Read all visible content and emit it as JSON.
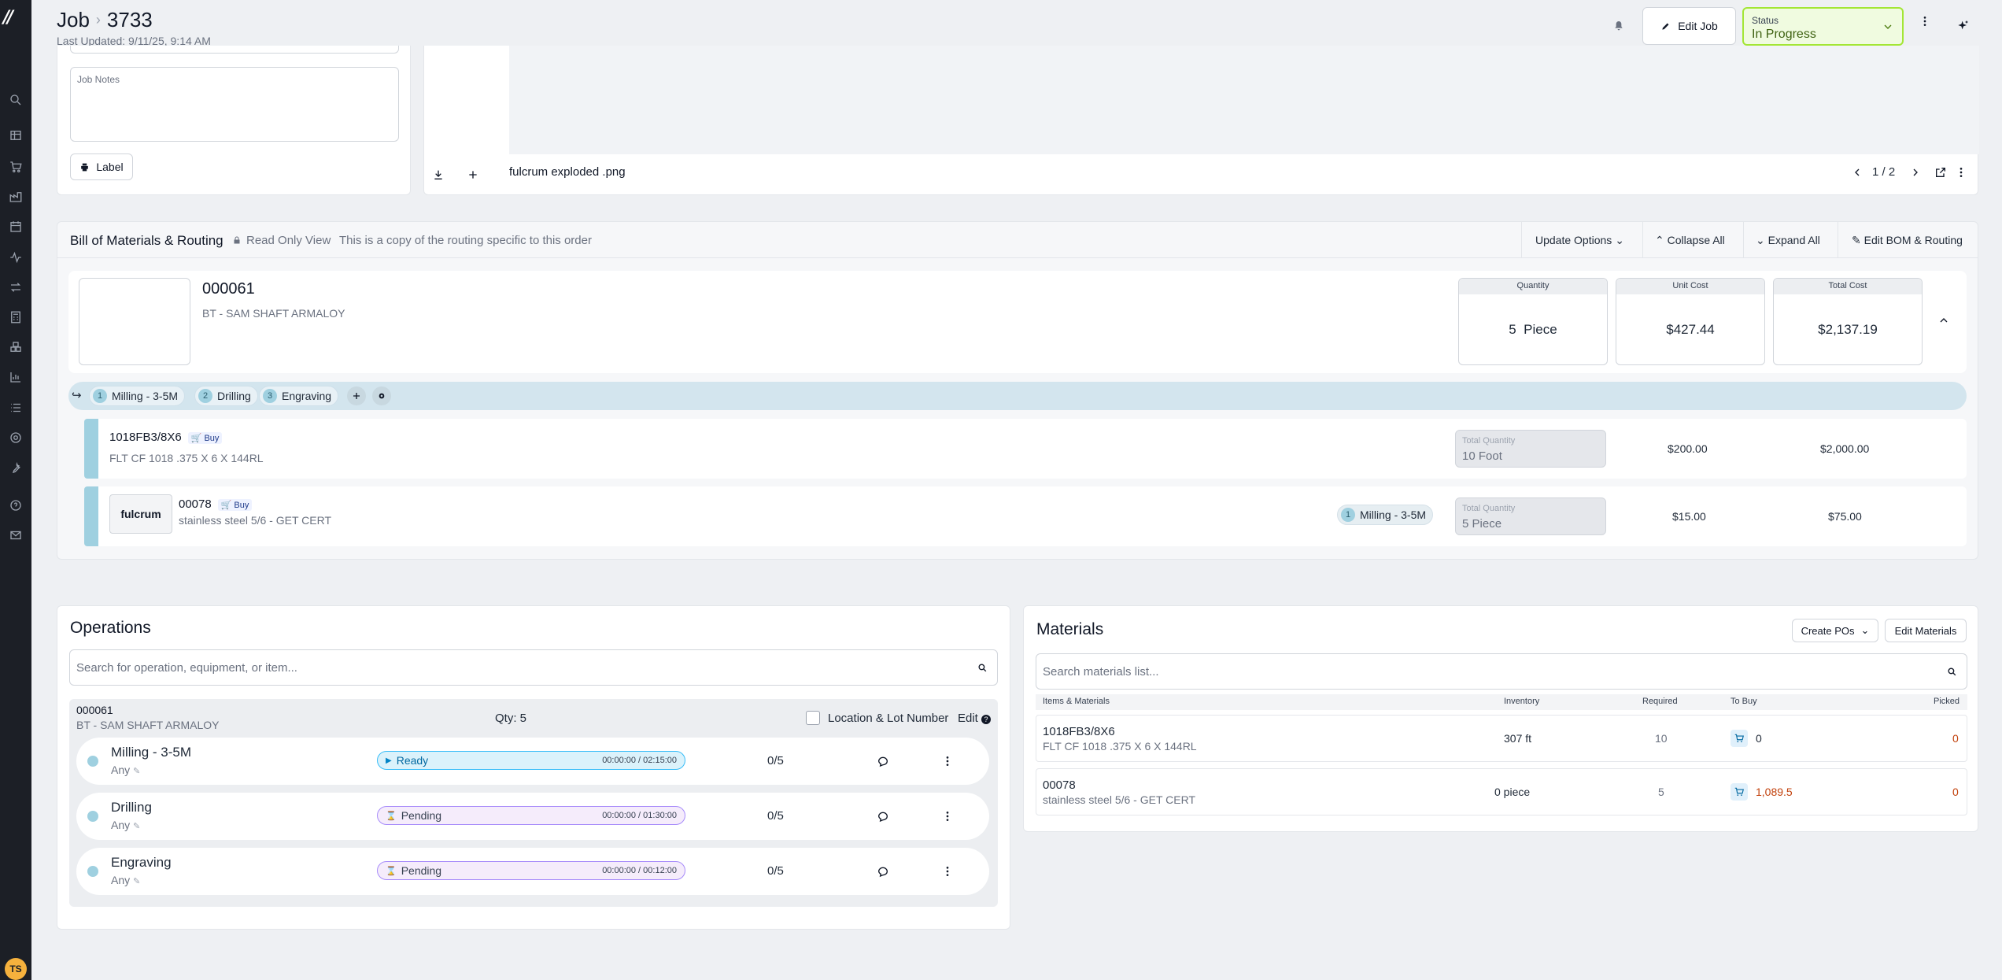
{
  "header": {
    "breadcrumb_root": "Job",
    "job_number": "3733",
    "last_updated": "Last Updated: 9/11/25, 9:14 AM",
    "edit_job_label": "Edit Job",
    "status_label": "Status",
    "status_value": "In Progress"
  },
  "job_panel": {
    "notes_placeholder": "Job Notes",
    "label_button": "Label"
  },
  "file_viewer": {
    "file_name": "fulcrum exploded .png",
    "page_indicator": "1 / 2"
  },
  "bom": {
    "title": "Bill of Materials & Routing",
    "read_only": "Read Only View",
    "note": "This is a copy of the routing specific to this order",
    "update_options": "Update Options",
    "collapse_all": "Collapse All",
    "expand_all": "Expand All",
    "edit_bom": "Edit BOM & Routing",
    "part": {
      "number": "000061",
      "description": "BT - SAM SHAFT ARMALOY",
      "quantity_label": "Quantity",
      "quantity_value": "5  Piece",
      "unit_cost_label": "Unit Cost",
      "unit_cost_value": "$427.44",
      "total_cost_label": "Total Cost",
      "total_cost_value": "$2,137.19"
    },
    "routing": [
      {
        "num": "1",
        "name": "Milling - 3-5M"
      },
      {
        "num": "2",
        "name": "Drilling"
      },
      {
        "num": "3",
        "name": "Engraving"
      }
    ],
    "materials": [
      {
        "number": "1018FB3/8X6",
        "buy": "Buy",
        "description": "FLT CF 1018 .375 X 6 X 144RL",
        "qty_label": "Total Quantity",
        "qty_value": "10 Foot",
        "unit": "$200.00",
        "total": "$2,000.00"
      },
      {
        "number": "00078",
        "buy": "Buy",
        "description": "stainless steel 5/6 - GET CERT",
        "thumb_text": "fulcrum",
        "op_num": "1",
        "op_name": "Milling - 3-5M",
        "qty_label": "Total Quantity",
        "qty_value": "5 Piece",
        "unit": "$15.00",
        "total": "$75.00"
      }
    ]
  },
  "operations": {
    "title": "Operations",
    "search_placeholder": "Search for operation, equipment, or item...",
    "group_number": "000061",
    "group_description": "BT - SAM SHAFT ARMALOY",
    "group_qty": "Qty: 5",
    "location_lot": "Location & Lot Number",
    "edit_label": "Edit",
    "rows": [
      {
        "name": "Milling - 3-5M",
        "assignee": "Any",
        "status": "Ready",
        "time": "00:00:00 / 02:15:00",
        "progress": "0/5"
      },
      {
        "name": "Drilling",
        "assignee": "Any",
        "status": "Pending",
        "time": "00:00:00 / 01:30:00",
        "progress": "0/5"
      },
      {
        "name": "Engraving",
        "assignee": "Any",
        "status": "Pending",
        "time": "00:00:00 / 00:12:00",
        "progress": "0/5"
      }
    ]
  },
  "materials_panel": {
    "title": "Materials",
    "create_pos": "Create POs",
    "edit_materials": "Edit Materials",
    "search_placeholder": "Search materials list...",
    "columns": [
      "Items & Materials",
      "Inventory",
      "Required",
      "To Buy",
      "Picked"
    ],
    "rows": [
      {
        "number": "1018FB3/8X6",
        "description": "FLT CF 1018 .375 X 6 X 144RL",
        "inventory": "307 ft",
        "required": "10",
        "to_buy": "0",
        "picked": "0"
      },
      {
        "number": "00078",
        "description": "stainless steel 5/6 - GET CERT",
        "inventory": "0 piece",
        "required": "5",
        "to_buy": "1,089.5",
        "picked": "0"
      }
    ]
  },
  "user": {
    "initials": "TS"
  },
  "colors": {
    "accent": "#a3e635",
    "ready": "#38bdf8",
    "pending": "#c084fc",
    "orange": "#c2410c",
    "routing_bar": "#d3e5ee"
  }
}
